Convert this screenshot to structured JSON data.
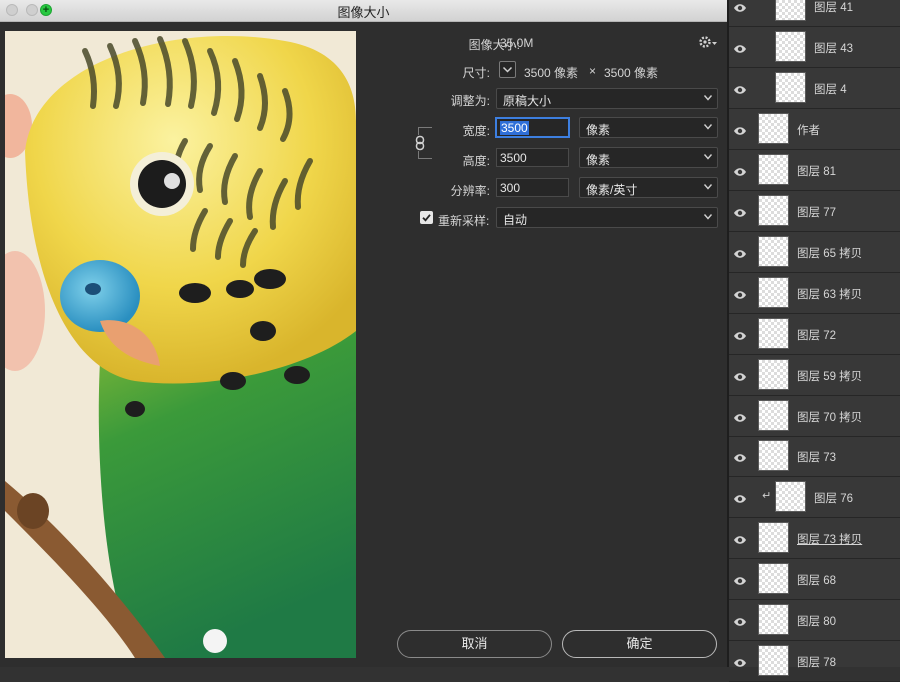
{
  "window": {
    "title": "图像大小"
  },
  "form": {
    "image_size_label": "图像大小:",
    "image_size_value": "35.0M",
    "dimensions_label": "尺寸:",
    "dimensions_w": "3500 像素",
    "dimensions_x": "×",
    "dimensions_h": "3500 像素",
    "fit_to_label": "调整为:",
    "fit_to_value": "原稿大小",
    "width_label": "宽度:",
    "width_value": "3500",
    "width_unit": "像素",
    "height_label": "高度:",
    "height_value": "3500",
    "height_unit": "像素",
    "resolution_label": "分辨率:",
    "resolution_value": "300",
    "resolution_unit": "像素/英寸",
    "resample_label": "重新采样:",
    "resample_checked": true,
    "resample_value": "自动",
    "cancel_label": "取消",
    "ok_label": "确定"
  },
  "layers": [
    {
      "name": "图层 41",
      "indent": true
    },
    {
      "name": "图层 43",
      "indent": true
    },
    {
      "name": "图层 4",
      "indent": true
    },
    {
      "name": "作者",
      "indent": false
    },
    {
      "name": "图层 81",
      "indent": false
    },
    {
      "name": "图层 77",
      "indent": false
    },
    {
      "name": "图层 65 拷贝",
      "indent": false
    },
    {
      "name": "图层 63 拷贝",
      "indent": false
    },
    {
      "name": "图层 72",
      "indent": false
    },
    {
      "name": "图层 59 拷贝",
      "indent": false
    },
    {
      "name": "图层 70 拷贝",
      "indent": false
    },
    {
      "name": "图层 73",
      "indent": false
    },
    {
      "name": "图层 76",
      "indent": true,
      "clipped": true
    },
    {
      "name": "图层 73 拷贝",
      "indent": false,
      "underlined": true
    },
    {
      "name": "图层 68",
      "indent": false
    },
    {
      "name": "图层 80",
      "indent": false
    },
    {
      "name": "图层 78",
      "indent": false
    }
  ],
  "colors": {
    "accent_blue": "#2f6fd8",
    "panel_bg": "#383838",
    "dialog_bg": "#2e2e2e"
  }
}
